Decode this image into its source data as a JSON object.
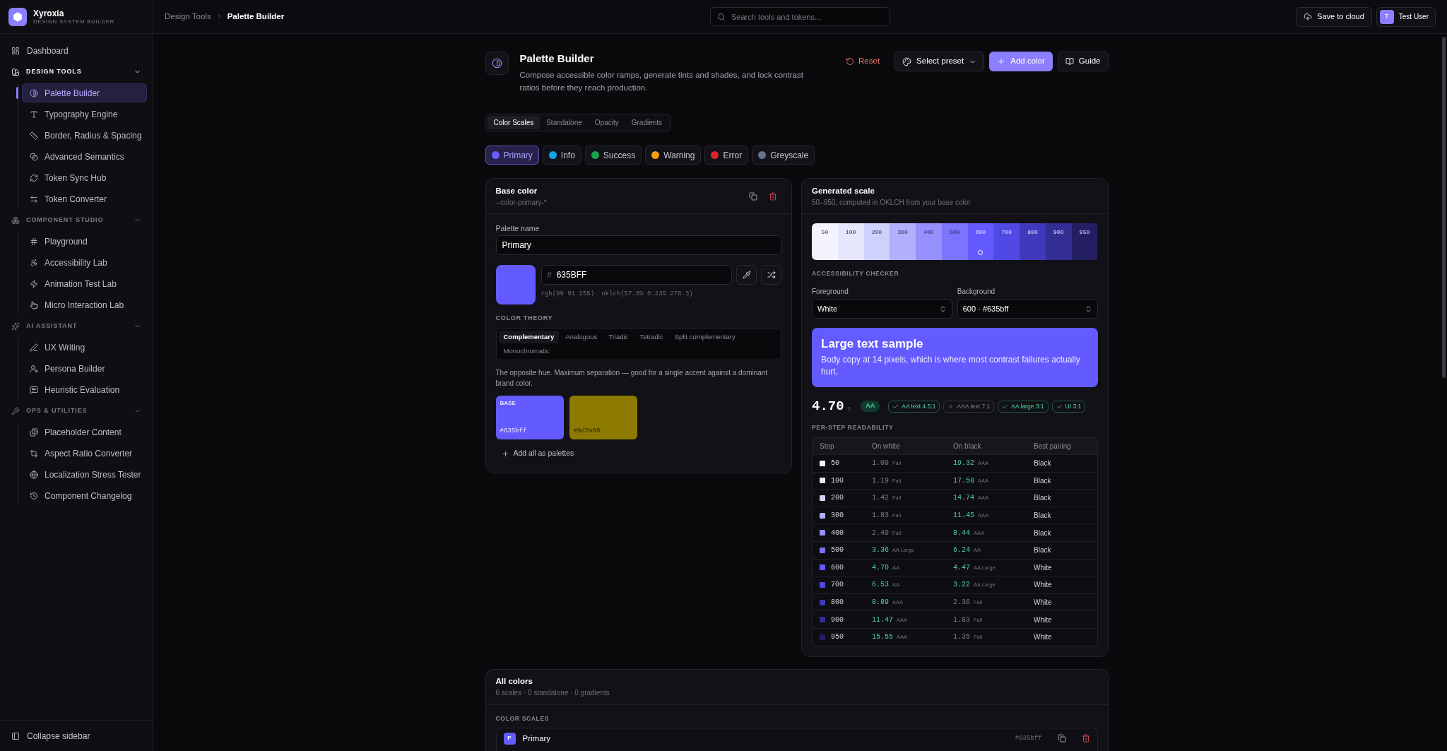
{
  "app": {
    "name": "Xyroxia",
    "tagline": "DESIGN SYSTEM BUILDER"
  },
  "sidebar": {
    "top_items": [
      {
        "label": "Dashboard",
        "selected": false
      }
    ],
    "sections": [
      {
        "title": "DESIGN TOOLS",
        "active": true,
        "expanded": true,
        "items": [
          {
            "label": "Palette Builder",
            "selected": true
          },
          {
            "label": "Typography Engine",
            "selected": false
          },
          {
            "label": "Border, Radius & Spacing",
            "selected": false
          },
          {
            "label": "Advanced Semantics",
            "selected": false
          },
          {
            "label": "Token Sync Hub",
            "selected": false
          },
          {
            "label": "Token Converter",
            "selected": false
          }
        ]
      },
      {
        "title": "COMPONENT STUDIO",
        "active": false,
        "expanded": true,
        "items": [
          {
            "label": "Playground",
            "selected": false
          },
          {
            "label": "Accessibility Lab",
            "selected": false
          },
          {
            "label": "Animation Test Lab",
            "selected": false
          },
          {
            "label": "Micro Interaction Lab",
            "selected": false
          }
        ]
      },
      {
        "title": "AI ASSISTANT",
        "active": false,
        "expanded": true,
        "items": [
          {
            "label": "UX Writing",
            "selected": false
          },
          {
            "label": "Persona Builder",
            "selected": false
          },
          {
            "label": "Heuristic Evaluation",
            "selected": false
          }
        ]
      },
      {
        "title": "OPS & UTILITIES",
        "active": false,
        "expanded": true,
        "items": [
          {
            "label": "Placeholder Content",
            "selected": false
          },
          {
            "label": "Aspect Ratio Converter",
            "selected": false
          },
          {
            "label": "Localization Stress Tester",
            "selected": false
          },
          {
            "label": "Component Changelog",
            "selected": false
          }
        ]
      }
    ],
    "footer": "Collapse sidebar"
  },
  "header": {
    "breadcrumb": [
      {
        "label": "Design Tools",
        "current": false
      },
      {
        "label": "Palette Builder",
        "current": true
      }
    ],
    "search": {
      "placeholder": "Search tools and tokens..."
    },
    "save_button": "Save to cloud",
    "user": {
      "initial": "T",
      "name": "Test User"
    }
  },
  "page": {
    "title": "Palette Builder",
    "description": "Compose accessible color ramps, generate tints and shades, and lock contrast ratios before they reach production.",
    "actions": [
      {
        "kind": "reset",
        "label": "Reset"
      },
      {
        "kind": "dropdown",
        "label": "Select preset"
      },
      {
        "kind": "primary",
        "label": "Add color"
      },
      {
        "kind": "guide",
        "label": "Guide"
      }
    ]
  },
  "tabs": [
    {
      "label": "Color Scales",
      "selected": true
    },
    {
      "label": "Standalone",
      "selected": false
    },
    {
      "label": "Opacity",
      "selected": false
    },
    {
      "label": "Gradients",
      "selected": false
    }
  ],
  "palettes": [
    {
      "label": "Primary",
      "color": "#6b5cff",
      "selected": true
    },
    {
      "label": "Info",
      "color": "#0ea5e9",
      "selected": false
    },
    {
      "label": "Success",
      "color": "#16a34a",
      "selected": false
    },
    {
      "label": "Warning",
      "color": "#f59e0b",
      "selected": false
    },
    {
      "label": "Error",
      "color": "#dc2626",
      "selected": false
    },
    {
      "label": "Greyscale",
      "color": "#64748b",
      "selected": false
    }
  ],
  "base_card": {
    "title": "Base color",
    "token": "--color-primary-*",
    "name_field": {
      "label": "Palette name",
      "value": "Primary"
    },
    "color": "#635bff",
    "hex_field": {
      "prefix": "#",
      "value": "635BFF"
    },
    "rgb": "rgb(99 91 255)",
    "oklch": "oklch(57.8% 0.235 278.3)",
    "theory": {
      "label": "COLOR THEORY",
      "tabs": [
        {
          "label": "Complementary",
          "selected": true
        },
        {
          "label": "Analogous",
          "selected": false
        },
        {
          "label": "Triadic",
          "selected": false
        },
        {
          "label": "Tetradic",
          "selected": false
        },
        {
          "label": "Split complementary",
          "selected": false
        },
        {
          "label": "Monochromatic",
          "selected": false
        }
      ],
      "description": "The opposite hue. Maximum separation — good for a single accent against a dominant brand color.",
      "swatches": [
        {
          "label": "BASE",
          "hex": "#635bff",
          "color": "#635bff"
        },
        {
          "hex": "#8d7a00",
          "color": "#8d7a00"
        }
      ],
      "add_all": "Add all as palettes"
    }
  },
  "scale_card": {
    "title": "Generated scale",
    "subtitle": "50–950, computed in OKLCH from your base color",
    "steps": [
      {
        "label": "50",
        "color": "#f4f4fe",
        "selected": false
      },
      {
        "label": "100",
        "color": "#e6e6fd",
        "selected": false
      },
      {
        "label": "200",
        "color": "#d0d0fc",
        "selected": false
      },
      {
        "label": "300",
        "color": "#b2b0fc",
        "selected": false
      },
      {
        "label": "400",
        "color": "#9690fc",
        "selected": false
      },
      {
        "label": "500",
        "color": "#7b74fc",
        "selected": false
      },
      {
        "label": "600",
        "color": "#635bff",
        "selected": true
      },
      {
        "label": "700",
        "color": "#5149e3",
        "selected": false
      },
      {
        "label": "800",
        "color": "#4039bb",
        "selected": false
      },
      {
        "label": "900",
        "color": "#332e93",
        "selected": false
      },
      {
        "label": "950",
        "color": "#241f63",
        "selected": false
      }
    ],
    "checker": {
      "label": "ACCESSIBILITY CHECKER",
      "foreground": {
        "label": "Foreground",
        "value": "White"
      },
      "background": {
        "label": "Background",
        "value": "600 · #635bff"
      },
      "sample": {
        "heading": "Large text sample",
        "body": "Body copy at 14 pixels, which is where most contrast failures actually hurt."
      },
      "ratio": "4.70",
      "ratio_suffix": ":1",
      "grade": "AA",
      "checks": [
        {
          "label": "AA text 4.5:1",
          "passed": true
        },
        {
          "label": "AAA text 7:1",
          "passed": false
        },
        {
          "label": "AA large 3:1",
          "passed": true
        },
        {
          "label": "UI 3:1",
          "passed": true
        }
      ]
    },
    "readability": {
      "label": "PER-STEP READABILITY",
      "columns": [
        "Step",
        "On white",
        "On black",
        "Best pairing"
      ],
      "rows": [
        {
          "step": "50",
          "color": "#f4f4fe",
          "on_white": {
            "value": "1.09",
            "rating": "Fail",
            "pass": false
          },
          "on_black": {
            "value": "19.32",
            "rating": "AAA",
            "pass": true
          },
          "best": "Black"
        },
        {
          "step": "100",
          "color": "#e6e6fd",
          "on_white": {
            "value": "1.19",
            "rating": "Fail",
            "pass": false
          },
          "on_black": {
            "value": "17.58",
            "rating": "AAA",
            "pass": true
          },
          "best": "Black"
        },
        {
          "step": "200",
          "color": "#d0d0fc",
          "on_white": {
            "value": "1.42",
            "rating": "Fail",
            "pass": false
          },
          "on_black": {
            "value": "14.74",
            "rating": "AAA",
            "pass": true
          },
          "best": "Black"
        },
        {
          "step": "300",
          "color": "#b2b0fc",
          "on_white": {
            "value": "1.83",
            "rating": "Fail",
            "pass": false
          },
          "on_black": {
            "value": "11.45",
            "rating": "AAA",
            "pass": true
          },
          "best": "Black"
        },
        {
          "step": "400",
          "color": "#9690fc",
          "on_white": {
            "value": "2.49",
            "rating": "Fail",
            "pass": false
          },
          "on_black": {
            "value": "8.44",
            "rating": "AAA",
            "pass": true
          },
          "best": "Black"
        },
        {
          "step": "500",
          "color": "#7b74fc",
          "on_white": {
            "value": "3.36",
            "rating": "AA Large",
            "pass": true
          },
          "on_black": {
            "value": "6.24",
            "rating": "AA",
            "pass": true
          },
          "best": "Black"
        },
        {
          "step": "600",
          "color": "#635bff",
          "on_white": {
            "value": "4.70",
            "rating": "AA",
            "pass": true
          },
          "on_black": {
            "value": "4.47",
            "rating": "AA Large",
            "pass": true
          },
          "best": "White"
        },
        {
          "step": "700",
          "color": "#5149e3",
          "on_white": {
            "value": "6.53",
            "rating": "AA",
            "pass": true
          },
          "on_black": {
            "value": "3.22",
            "rating": "AA Large",
            "pass": true
          },
          "best": "White"
        },
        {
          "step": "800",
          "color": "#4039bb",
          "on_white": {
            "value": "8.89",
            "rating": "AAA",
            "pass": true
          },
          "on_black": {
            "value": "2.36",
            "rating": "Fail",
            "pass": false
          },
          "best": "White"
        },
        {
          "step": "900",
          "color": "#332e93",
          "on_white": {
            "value": "11.47",
            "rating": "AAA",
            "pass": true
          },
          "on_black": {
            "value": "1.83",
            "rating": "Fail",
            "pass": false
          },
          "best": "White"
        },
        {
          "step": "950",
          "color": "#241f63",
          "on_white": {
            "value": "15.55",
            "rating": "AAA",
            "pass": true
          },
          "on_black": {
            "value": "1.35",
            "rating": "Fail",
            "pass": false
          },
          "best": "White"
        }
      ]
    }
  },
  "all_colors": {
    "title": "All colors",
    "subtitle": "6 scales · 0 standalone · 0 gradients",
    "section_label": "COLOR SCALES",
    "rows": [
      {
        "initial": "P",
        "name": "Primary",
        "hex": "#635bff",
        "color": "#635bff"
      }
    ]
  }
}
